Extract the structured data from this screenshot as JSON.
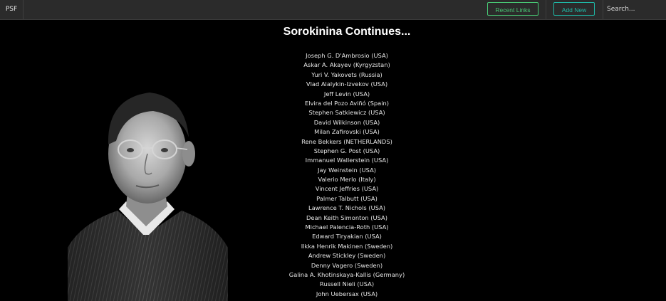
{
  "nav": {
    "brand": "PSF",
    "recent_links_label": "Recent Links",
    "add_new_label": "Add New",
    "search_placeholder": "Search..."
  },
  "main": {
    "title": "Sorokinina Continues...",
    "names": [
      "Joseph G. D'Ambrosio (USA)",
      "Askar A. Akayev (Kyrgyzstan)",
      "Yuri V. Yakovets (Russia)",
      "Vlad Alalykin-Izvekov (USA)",
      "Jeff Levin (USA)",
      "Elvira del Pozo Aviñó (Spain)",
      "Stephen Satkiewicz (USA)",
      "David Wilkinson (USA)",
      "Milan Zafirovski (USA)",
      "Rene Bekkers (NETHERLANDS)",
      "Stephen G. Post (USA)",
      "Immanuel Wallerstein (USA)",
      "Jay Weinstein (USA)",
      "Valerio Merlo (Italy)",
      "Vincent Jeffries (USA)",
      "Palmer Talbutt (USA)",
      "Lawrence T. Nichols (USA)",
      "Dean Keith Simonton (USA)",
      "Michael Palencia-Roth (USA)",
      "Edward Tiryakian (USA)",
      "Ilkka Henrik Makinen (Sweden)",
      "Andrew Stickley (Sweden)",
      "Denny Vagero (Sweden)",
      "Galina A. Khotinskaya-Kallis (Germany)",
      "Russell Nieli (USA)",
      "John Uebersax (USA)"
    ]
  },
  "colors": {
    "nav_bg": "#2b2b2b",
    "page_bg": "#000000",
    "recent_links_accent": "#48c774",
    "add_new_accent": "#1fb8a6"
  }
}
